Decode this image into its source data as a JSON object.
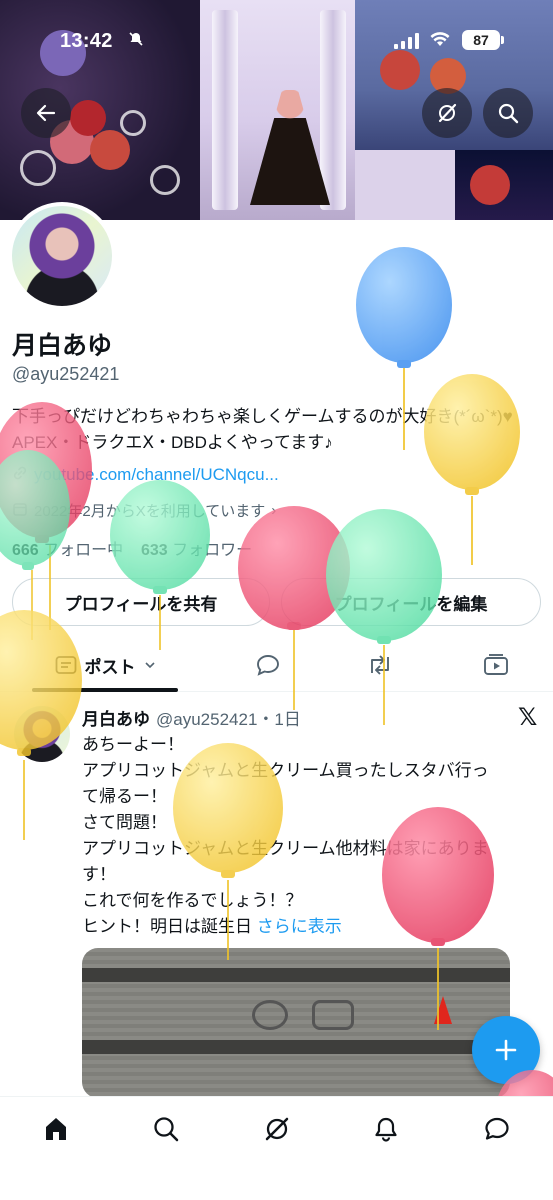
{
  "status_bar": {
    "time": "13:42",
    "battery": "87"
  },
  "profile": {
    "display_name": "月白あゆ",
    "handle": "@ayu252421",
    "bio": "下手っぴだけどわちゃわちゃ楽しくゲームするのが大好き(*´ω`*)♥ APEX・ドラクエⅩ・DBDよくやってます♪",
    "link": "youtube.com/channel/UCNqcu...",
    "joined": "2022年2月からXを利用しています",
    "following_count": "666",
    "following_label": "フォロー中",
    "followers_count": "633",
    "followers_label": "フォロワー"
  },
  "buttons": {
    "share": "プロフィールを共有",
    "edit": "プロフィールを編集"
  },
  "tabs": {
    "posts": "ポスト"
  },
  "post": {
    "author": "月白あゆ",
    "handle_time": "@ayu252421・1日",
    "lines": [
      "あちーよー！",
      "アプリコットジャムと生クリーム買ったしスタバ行っ",
      "て帰るー！",
      "さて問題！",
      "アプリコットジャムと生クリーム他材料は家にありま",
      "す！",
      "これで何を作るでしょう！？"
    ],
    "last_line": "ヒント！明日は誕生日",
    "show_more": "さらに表示"
  },
  "colors": {
    "accent": "#1d9bf0",
    "text": "#0f1419",
    "secondary": "#536471"
  },
  "icons": [
    "back-arrow-icon",
    "grok-icon",
    "search-icon",
    "posts-icon",
    "replies-icon",
    "reposts-icon",
    "media-icon",
    "x-logo-icon",
    "compose-plus-icon",
    "home-icon",
    "explore-icon",
    "grok-nav-icon",
    "notifications-icon",
    "messages-icon"
  ]
}
